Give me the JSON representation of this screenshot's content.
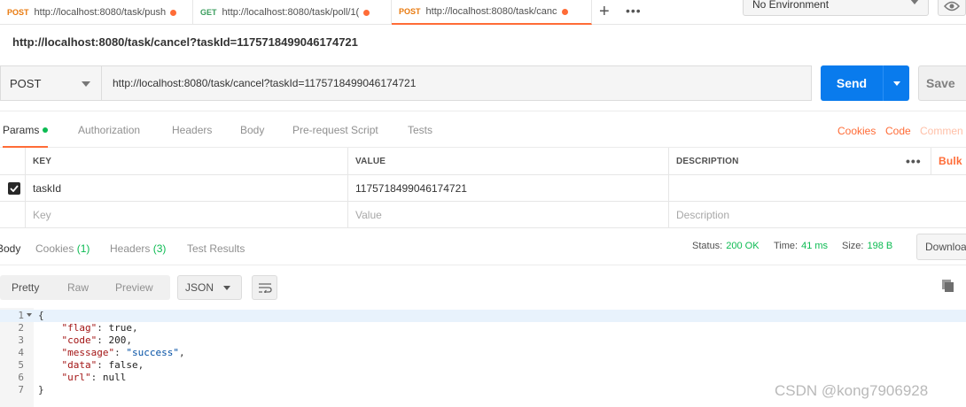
{
  "tabs": [
    {
      "method": "POST",
      "url": "http://localhost:8080/task/push"
    },
    {
      "method": "GET",
      "url": "http://localhost:8080/task/poll/1("
    },
    {
      "method": "POST",
      "url": "http://localhost:8080/task/canc"
    }
  ],
  "tab_add_label": "+",
  "tab_more_label": "•••",
  "environment": {
    "selected": "No Environment"
  },
  "request": {
    "title": "http://localhost:8080/task/cancel?taskId=1175718499046174721",
    "method": "POST",
    "url": "http://localhost:8080/task/cancel?taskId=1175718499046174721",
    "send_label": "Send",
    "save_label": "Save"
  },
  "request_tabs": {
    "params": "Params",
    "authorization": "Authorization",
    "headers": "Headers",
    "body": "Body",
    "prerequest": "Pre-request Script",
    "tests": "Tests",
    "cookies": "Cookies",
    "code": "Code",
    "comments": "Commen"
  },
  "params_table": {
    "headers": {
      "key": "KEY",
      "value": "VALUE",
      "description": "DESCRIPTION",
      "more": "•••",
      "bulk": "Bulk"
    },
    "rows": [
      {
        "key": "taskId",
        "value": "1175718499046174721",
        "description": ""
      }
    ],
    "placeholder": {
      "key": "Key",
      "value": "Value",
      "description": "Description"
    }
  },
  "response": {
    "tabs": {
      "body": "Body",
      "cookies": "Cookies",
      "cookies_count": "(1)",
      "headers": "Headers",
      "headers_count": "(3)",
      "test_results": "Test Results"
    },
    "status_label": "Status:",
    "status_value": "200 OK",
    "time_label": "Time:",
    "time_value": "41 ms",
    "size_label": "Size:",
    "size_value": "198 B",
    "download_label": "Downloa",
    "format": {
      "pretty": "Pretty",
      "raw": "Raw",
      "preview": "Preview",
      "language": "JSON"
    },
    "line_numbers": [
      "1",
      "2",
      "3",
      "4",
      "5",
      "6",
      "7"
    ],
    "code": {
      "open": "{",
      "flag_key": "\"flag\"",
      "flag_val": "true",
      "code_key": "\"code\"",
      "code_val": "200",
      "message_key": "\"message\"",
      "message_val": "\"success\"",
      "data_key": "\"data\"",
      "data_val": "false",
      "url_key": "\"url\"",
      "url_val": "null",
      "close": "}"
    }
  },
  "watermark": "CSDN @kong7906928"
}
